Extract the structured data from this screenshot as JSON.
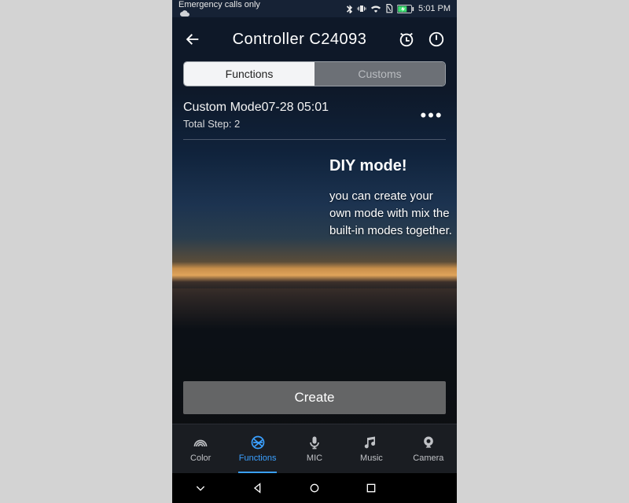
{
  "status": {
    "left": "Emergency calls only",
    "time": "5:01 PM"
  },
  "header": {
    "title": "Controller  C24093"
  },
  "tabs": {
    "left": "Functions",
    "right": "Customs"
  },
  "mode_item": {
    "name": "Custom Mode07-28 05:01",
    "sub": "Total Step: 2"
  },
  "overlay": {
    "title": "DIY mode!",
    "body": "you can create your own mode with mix the built-in modes together."
  },
  "create_label": "Create",
  "bottom": [
    {
      "label": "Color"
    },
    {
      "label": "Functions"
    },
    {
      "label": "MIC"
    },
    {
      "label": "Music"
    },
    {
      "label": "Camera"
    }
  ]
}
